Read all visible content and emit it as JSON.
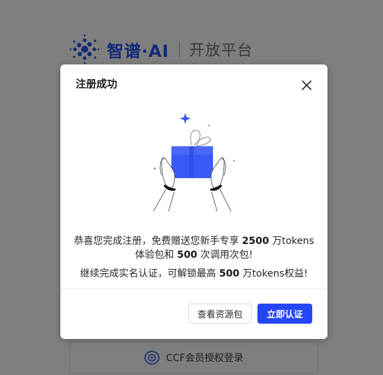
{
  "colors": {
    "overlay": "#7f7f7f",
    "brand": "#122a78",
    "accent": "#2546f5",
    "gift": "#3a5af6"
  },
  "background": {
    "brand_name": "智谱·AI",
    "brand_sub": "开放平台",
    "ccf_login_label": "CCF会员授权登录"
  },
  "dialog": {
    "title": "注册成功",
    "message1": {
      "prefix": "恭喜您完成注册，免费赠送您新手专享 ",
      "tokens_amount": "2500",
      "mid": " 万tokens",
      "line2_prefix": "体验包和 ",
      "calls_amount": "500",
      "suffix": " 次调用次包!"
    },
    "message2": {
      "prefix": "继续完成实名认证，可解锁最高 ",
      "amount": "500",
      "suffix": " 万tokens权益!"
    },
    "buttons": {
      "view_package": "查看资源包",
      "verify_now": "立即认证"
    },
    "icons": {
      "close": "close-icon",
      "illustration": "gift-in-hands-illustration"
    }
  }
}
